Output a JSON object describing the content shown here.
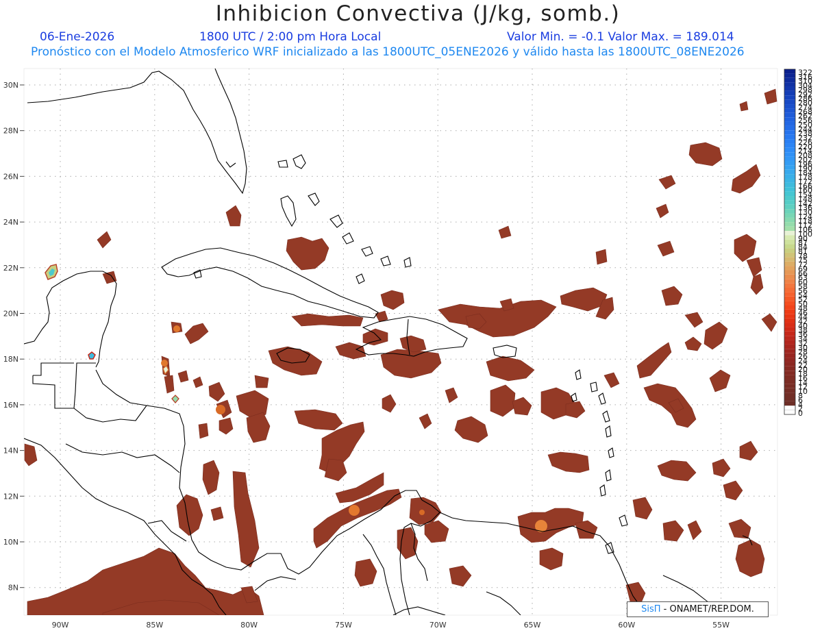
{
  "title": "Inhibicion Convectiva (J/kg, somb.)",
  "date": "06-Ene-2026",
  "time": "1800 UTC / 2:00 pm Hora Local",
  "minmax": "Valor Min. = -0.1  Valor Max. = 189.014",
  "model_info": "Pronóstico con el Modelo Atmosferico WRF inicializado a las 1800UTC_05ENE2026 y válido hasta las  1800UTC_08ENE2026",
  "credit_brand": "SisΠ",
  "credit_text": " - ONAMET/REP.DOM.",
  "lon_labels": [
    "90W",
    "85W",
    "80W",
    "75W",
    "70W",
    "65W",
    "60W",
    "55W"
  ],
  "lat_labels": [
    "30N",
    "28N",
    "26N",
    "24N",
    "22N",
    "20N",
    "18N",
    "16N",
    "14N",
    "12N",
    "10N",
    "8N"
  ],
  "colorbar_labels": [
    "322",
    "316",
    "310",
    "304",
    "298",
    "292",
    "286",
    "280",
    "274",
    "268",
    "262",
    "256",
    "250",
    "244",
    "238",
    "232",
    "226",
    "220",
    "214",
    "208",
    "202",
    "196",
    "190",
    "184",
    "178",
    "172",
    "166",
    "160",
    "154",
    "148",
    "142",
    "136",
    "130",
    "124",
    "118",
    "112",
    "106",
    "100",
    "90",
    "87",
    "84",
    "81",
    "78",
    "75",
    "72",
    "69",
    "66",
    "63",
    "60",
    "58",
    "56",
    "54",
    "52",
    "50",
    "48",
    "46",
    "44",
    "42",
    "40",
    "38",
    "36",
    "34",
    "32",
    "30",
    "28",
    "26",
    "24",
    "22",
    "20",
    "18",
    "16",
    "14",
    "12",
    "10",
    "8",
    "6",
    "4",
    "2",
    "0"
  ],
  "colorbar_colors": [
    "#0a1f8c",
    "#0c2594",
    "#0e2b9c",
    "#1031a4",
    "#1237ad",
    "#143db5",
    "#1643bd",
    "#1849c4",
    "#1a4fcb",
    "#1c55d2",
    "#1e5bd8",
    "#2061de",
    "#2267e3",
    "#246de8",
    "#2673ec",
    "#2879f0",
    "#2a7ff3",
    "#2c85f5",
    "#2e8bf6",
    "#3091f6",
    "#3297f5",
    "#349df3",
    "#36a3f0",
    "#38a9ec",
    "#3aafe8",
    "#3cb5e3",
    "#3ebbdd",
    "#40c1d8",
    "#44c6d2",
    "#4ccacc",
    "#56cdc6",
    "#60d0c0",
    "#6cd3ba",
    "#78d6b4",
    "#86d9b0",
    "#94dcac",
    "#a2dfaa",
    "#e8f2d6",
    "#d8eab2",
    "#cfe29e",
    "#c7d98c",
    "#c9cf80",
    "#d0c478",
    "#d6b970",
    "#dcae66",
    "#e2a35e",
    "#e69856",
    "#ea8d4e",
    "#ee8246",
    "#f2773e",
    "#f46c36",
    "#f5622e",
    "#f55826",
    "#f44e20",
    "#f2441a",
    "#ee3c16",
    "#e83614",
    "#e13114",
    "#d92d16",
    "#d02a18",
    "#c6281a",
    "#bc271c",
    "#b2261e",
    "#a8261f",
    "#9f2620",
    "#982621",
    "#922722",
    "#8c2822",
    "#872a23",
    "#832b24",
    "#7f2c24",
    "#7b2d25",
    "#782d25",
    "#752e26",
    "#722e26",
    "#702f27",
    "#6e2f27",
    "#ffffff",
    "#ffffff"
  ]
}
